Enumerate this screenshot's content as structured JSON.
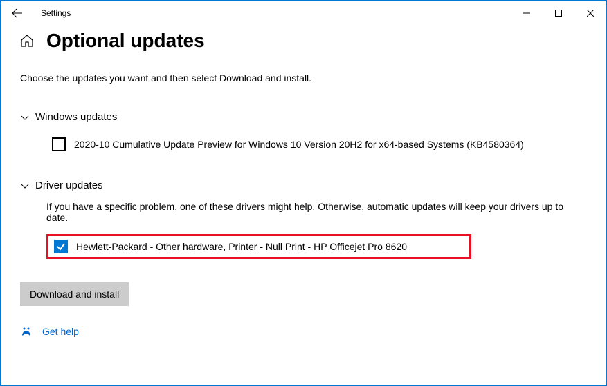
{
  "titlebar": {
    "app_title": "Settings"
  },
  "header": {
    "page_title": "Optional updates"
  },
  "intro_text": "Choose the updates you want and then select Download and install.",
  "sections": {
    "windows": {
      "title": "Windows updates",
      "items": [
        {
          "label": "2020-10 Cumulative Update Preview for Windows 10 Version 20H2 for x64-based Systems (KB4580364)",
          "checked": false
        }
      ]
    },
    "drivers": {
      "title": "Driver updates",
      "hint": "If you have a specific problem, one of these drivers might help. Otherwise, automatic updates will keep your drivers up to date.",
      "items": [
        {
          "label": "Hewlett-Packard  - Other hardware, Printer - Null Print - HP Officejet Pro 8620",
          "checked": true
        }
      ]
    }
  },
  "download_button_label": "Download and install",
  "help_link_label": "Get help"
}
